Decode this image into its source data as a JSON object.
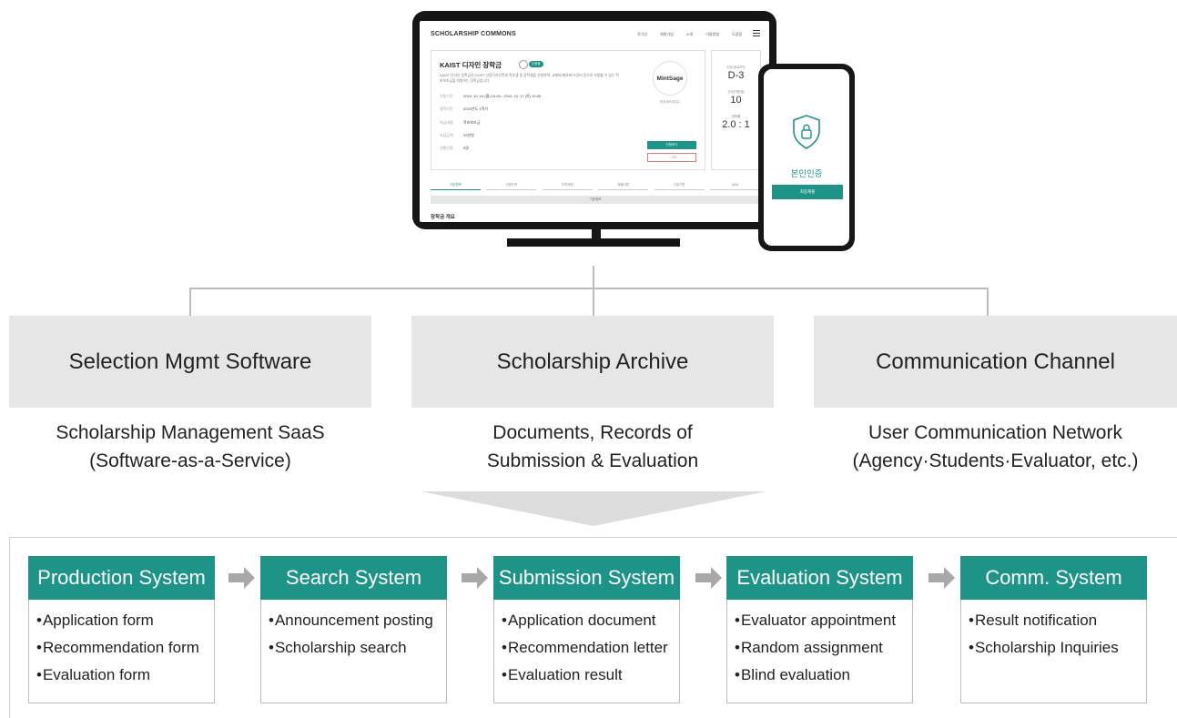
{
  "screen": {
    "brand": "SCHOLARSHIP COMMONS",
    "nav_links": [
      "로그인",
      "회원가입",
      "소개",
      "이용방법",
      "도움말"
    ],
    "scholarship": {
      "title": "KAIST 디자인 장학금",
      "badge": "신청중",
      "description": "KAIST 디자인 장학금은 KAIST 산업디자인학과 학부생 중 장학생을 선발하여, 교재비/재료비/수강비 등으로 사용할 수 있는 학비보조금을 지원하는 장학금입니다.",
      "rows": [
        {
          "key": "신청기간",
          "value": "2019. 10. 14 (월) 10:00 - 2019. 10. 17 (목) 10:00"
        },
        {
          "key": "장학기간",
          "value": "2019년도 1학기"
        },
        {
          "key": "지급내용",
          "value": "학비보조금"
        },
        {
          "key": "지급금액",
          "value": "20만원"
        },
        {
          "key": "선발인원",
          "value": "5명"
        }
      ],
      "provider_logo": "MintSage",
      "provider_name": "민트세이지(주)",
      "apply_label": "신청하기",
      "like_count": "100"
    },
    "stats": [
      {
        "label": "신청 종료까지",
        "value": "D-3"
      },
      {
        "label": "신청인원(명)",
        "value": "10"
      },
      {
        "label": "경쟁률",
        "value": "2.0 : 1"
      }
    ],
    "tabs": [
      "기본정보",
      "신청자격",
      "지격제한",
      "제출서류",
      "선발기준",
      "Q&A"
    ],
    "active_tab": 0,
    "section_bar": "기본정보",
    "section_title": "장학금 개요"
  },
  "phone": {
    "icon": "shield-lock-icon",
    "title": "본인인증",
    "button": "최종제출"
  },
  "categories": [
    {
      "title": "Selection Mgmt Software",
      "desc": [
        "Scholarship Management SaaS",
        "(Software-as-a-Service)"
      ]
    },
    {
      "title": "Scholarship Archive",
      "desc": [
        "Documents, Records of",
        "Submission & Evaluation"
      ]
    },
    {
      "title": "Communication Channel",
      "desc": [
        "User Communication Network",
        "(Agency·Students·Evaluator, etc.)"
      ]
    }
  ],
  "systems": [
    {
      "title": "Production System",
      "items": [
        "Application form",
        "Recommendation form",
        "Evaluation form"
      ]
    },
    {
      "title": "Search System",
      "items": [
        "Announcement posting",
        "Scholarship search"
      ]
    },
    {
      "title": "Submission System",
      "items": [
        "Application document",
        "Recommendation letter",
        "Evaluation result"
      ]
    },
    {
      "title": "Evaluation System",
      "items": [
        "Evaluator appointment",
        "Random assignment",
        "Blind evaluation"
      ]
    },
    {
      "title": "Comm. System",
      "items": [
        "Result notification",
        "Scholarship Inquiries"
      ]
    }
  ],
  "colors": {
    "accent": "#1e9488",
    "box_gray": "#e6e6e6",
    "arrow_gray": "#a8a8a8",
    "device": "#161616"
  }
}
